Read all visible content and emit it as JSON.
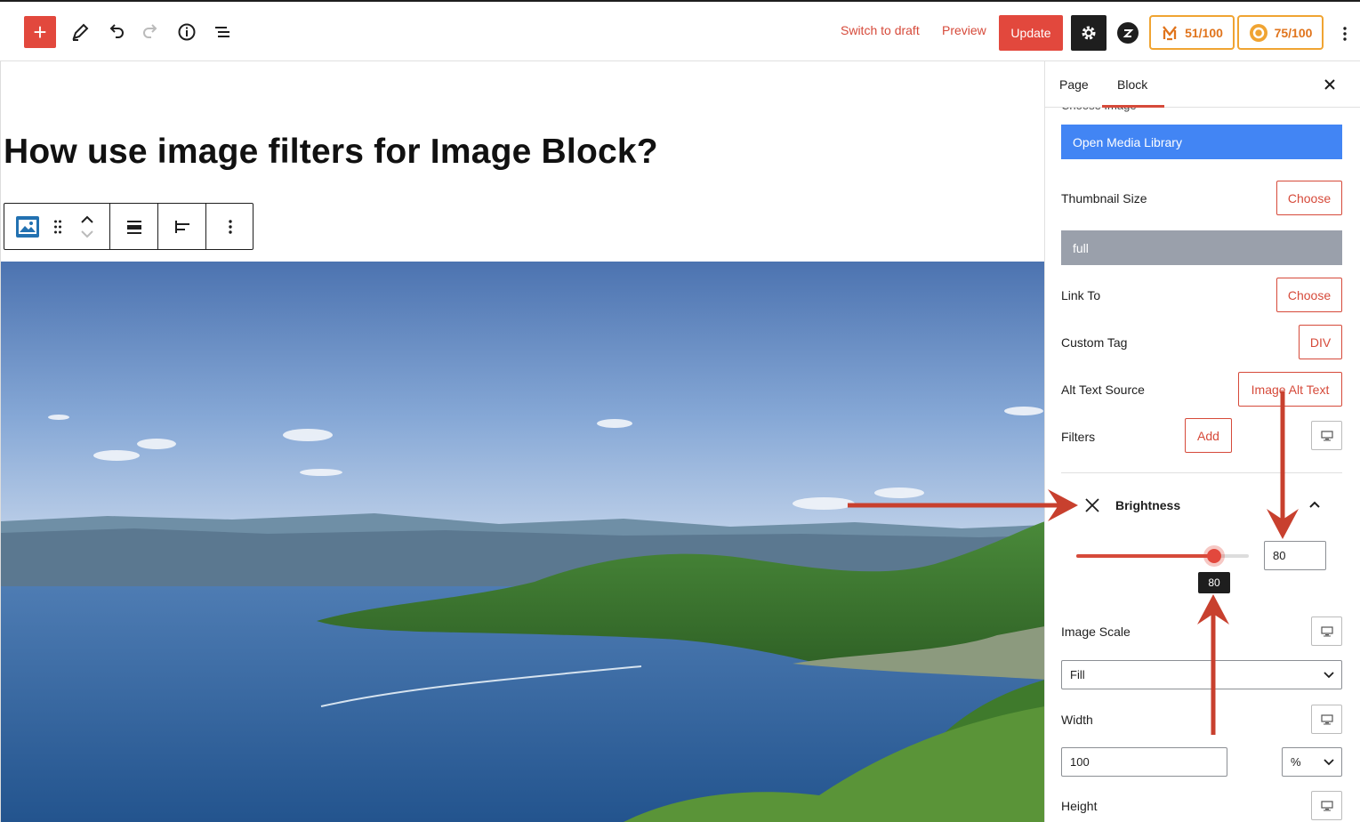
{
  "toolbar": {
    "add_label": "+",
    "switch_to_draft": "Switch to draft",
    "preview": "Preview",
    "update": "Update",
    "score_1": "51/100",
    "score_2": "75/100"
  },
  "post": {
    "title": "How use image filters for Image Block?"
  },
  "sidebar": {
    "tabs": [
      "Page",
      "Block"
    ],
    "active_tab": "Block",
    "ghost_label": "Choose Image",
    "open_media_library": "Open Media Library",
    "thumbnail_size_label": "Thumbnail Size",
    "thumbnail_size_button": "Choose",
    "thumbnail_size_value": "full",
    "link_to_label": "Link To",
    "link_to_button": "Choose",
    "custom_tag_label": "Custom Tag",
    "custom_tag_button": "DIV",
    "alt_text_source_label": "Alt Text Source",
    "alt_text_source_button": "Image Alt Text",
    "filters_label": "Filters",
    "filters_add_button": "Add",
    "brightness": {
      "title": "Brightness",
      "value": "80",
      "tooltip": "80",
      "level_percent": 80
    },
    "image_scale_label": "Image Scale",
    "image_scale_value": "Fill",
    "width_label": "Width",
    "width_value": "100",
    "width_unit": "%",
    "height_label": "Height"
  },
  "colors": {
    "accent": "#e2483d",
    "link": "#d64a3a",
    "media_button": "#4285f4",
    "annotation_arrow": "#c8402e"
  }
}
